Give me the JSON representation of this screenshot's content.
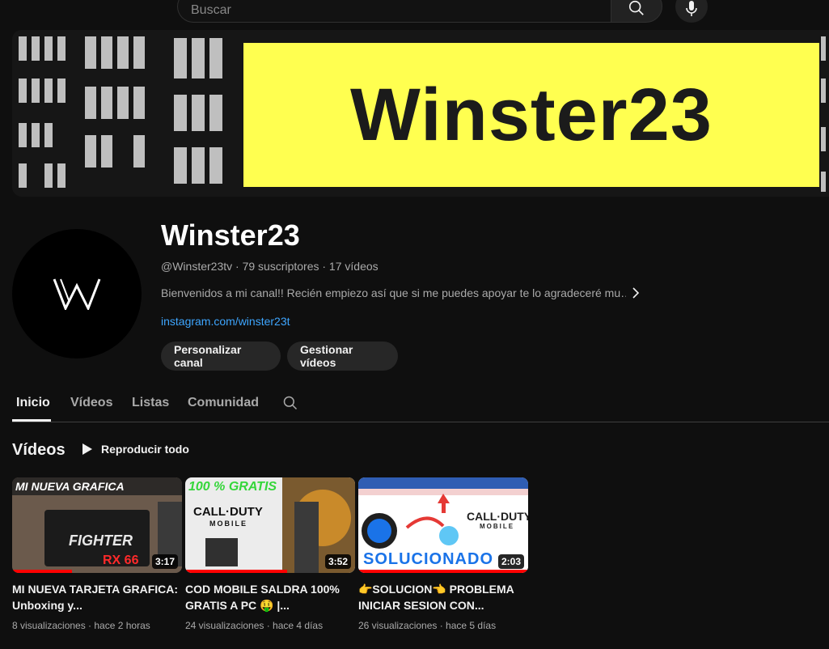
{
  "search": {
    "placeholder": "Buscar"
  },
  "banner": {
    "title": "Winster23",
    "plate_color": "#ffff50"
  },
  "channel": {
    "name": "Winster23",
    "meta": "@Winster23tv · 79 suscriptores · 17 vídeos",
    "description": "Bienvenidos a mi canal!! Recién empiezo así que si me puedes apoyar te lo agradeceré mu…",
    "link": "instagram.com/winster23t",
    "buttons": {
      "customize": "Personalizar canal",
      "manage": "Gestionar vídeos"
    }
  },
  "tabs": [
    {
      "label": "Inicio"
    },
    {
      "label": "Vídeos"
    },
    {
      "label": "Listas"
    },
    {
      "label": "Comunidad"
    }
  ],
  "section": {
    "title": "Vídeos",
    "play_all": "Reproducir todo"
  },
  "videos": [
    {
      "thumb_text": "MI NUEVA GRAFICA",
      "thumb_text2": "FIGHTER",
      "thumb_text3": "RX 66",
      "duration": "3:17",
      "watched": 0.35,
      "title": "MI NUEVA TARJETA GRAFICA: Unboxing y...",
      "meta": "8 visualizaciones · hace 2 horas"
    },
    {
      "thumb_text": "100 % GRATIS",
      "thumb_text2": "CALL·DUTY",
      "thumb_text3": "MOBILE",
      "duration": "3:52",
      "watched": 0.6,
      "title": "COD MOBILE SALDRA 100% GRATIS A PC 🤑 |...",
      "meta": "24 visualizaciones · hace 4 días"
    },
    {
      "thumb_text": "SOLUCIONADO",
      "thumb_text2": "CALL·DUTY",
      "thumb_text3": "MOBILE",
      "duration": "2:03",
      "watched": 1.0,
      "title": "👉SOLUCION👈 PROBLEMA INICIAR SESION CON...",
      "meta": "26 visualizaciones · hace 5 días"
    }
  ]
}
